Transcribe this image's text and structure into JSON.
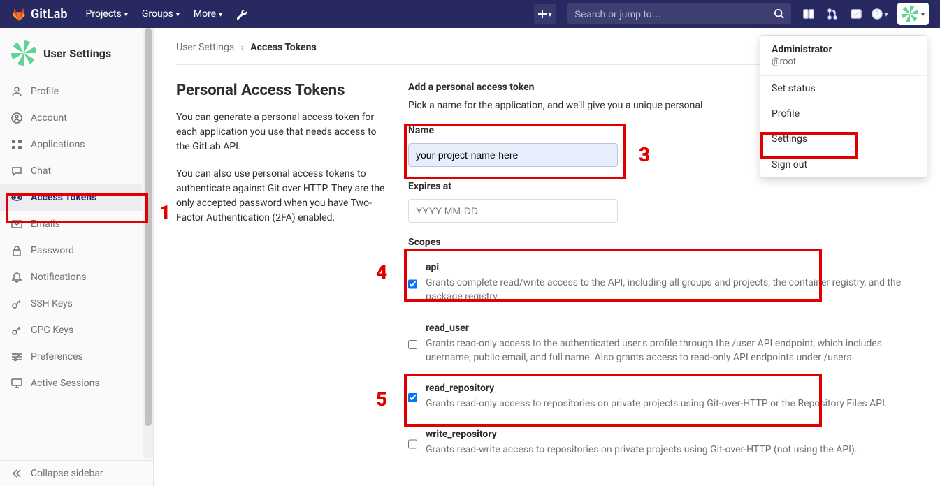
{
  "nav": {
    "brand": "GitLab",
    "projects": "Projects",
    "groups": "Groups",
    "more": "More",
    "search_placeholder": "Search or jump to…"
  },
  "user_menu": {
    "display_name": "Administrator",
    "handle": "@root",
    "set_status": "Set status",
    "profile": "Profile",
    "settings": "Settings",
    "sign_out": "Sign out"
  },
  "sidebar": {
    "title": "User Settings",
    "items": [
      {
        "label": "Profile"
      },
      {
        "label": "Account"
      },
      {
        "label": "Applications"
      },
      {
        "label": "Chat"
      },
      {
        "label": "Access Tokens"
      },
      {
        "label": "Emails"
      },
      {
        "label": "Password"
      },
      {
        "label": "Notifications"
      },
      {
        "label": "SSH Keys"
      },
      {
        "label": "GPG Keys"
      },
      {
        "label": "Preferences"
      },
      {
        "label": "Active Sessions"
      }
    ],
    "collapse": "Collapse sidebar"
  },
  "breadcrumb": {
    "root": "User Settings",
    "current": "Access Tokens"
  },
  "page": {
    "title": "Personal Access Tokens",
    "desc1": "You can generate a personal access token for each application you use that needs access to the GitLab API.",
    "desc2": "You can also use personal access tokens to authenticate against Git over HTTP. They are the only accepted password when you have Two-Factor Authentication (2FA) enabled."
  },
  "form": {
    "add_title": "Add a personal access token",
    "add_sub": "Pick a name for the application, and we'll give you a unique personal",
    "name_label": "Name",
    "name_value": "your-project-name-here",
    "expires_label": "Expires at",
    "expires_placeholder": "YYYY-MM-DD",
    "scopes_label": "Scopes",
    "scopes": [
      {
        "key": "api",
        "checked": true,
        "desc": "Grants complete read/write access to the API, including all groups and projects, the container registry, and the package registry."
      },
      {
        "key": "read_user",
        "checked": false,
        "desc": "Grants read-only access to the authenticated user's profile through the /user API endpoint, which includes username, public email, and full name. Also grants access to read-only API endpoints under /users."
      },
      {
        "key": "read_repository",
        "checked": true,
        "desc": "Grants read-only access to repositories on private projects using Git-over-HTTP or the Repository Files API."
      },
      {
        "key": "write_repository",
        "checked": false,
        "desc": "Grants read-write access to repositories on private projects using Git-over-HTTP (not using the API)."
      }
    ]
  },
  "annotations": {
    "n1": "1",
    "n3": "3",
    "n4": "4",
    "n5": "5"
  }
}
